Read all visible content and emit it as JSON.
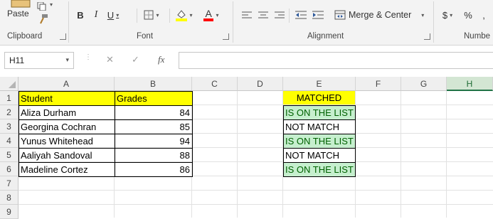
{
  "ribbon": {
    "clipboard": {
      "paste_label": "Paste",
      "group_label": "Clipboard"
    },
    "font": {
      "bold": "B",
      "italic": "I",
      "underline": "U",
      "font_color_letter": "A",
      "group_label": "Font",
      "highlight_color": "#ffff00",
      "font_color": "#ff0000"
    },
    "alignment": {
      "merge_label": "Merge & Center",
      "group_label": "Alignment"
    },
    "number": {
      "currency": "$",
      "percent": "%",
      "group_label": "Numbe"
    }
  },
  "formula_bar": {
    "name_box": "H11",
    "fx": "fx",
    "cancel": "✕",
    "enter": "✓",
    "formula": ""
  },
  "sheet": {
    "columns": [
      "A",
      "B",
      "C",
      "D",
      "E",
      "F",
      "G",
      "H"
    ],
    "selected_column": "H",
    "rows": [
      "1",
      "2",
      "3",
      "4",
      "5",
      "6",
      "7",
      "8",
      "9"
    ],
    "headers": {
      "student": "Student",
      "grades": "Grades",
      "matched": "MATCHED"
    },
    "students": [
      {
        "name": "Aliza Durham",
        "grade": "84",
        "matched": "IS ON THE LIST"
      },
      {
        "name": "Georgina Cochran",
        "grade": "85",
        "matched": "NOT MATCH"
      },
      {
        "name": "Yunus Whitehead",
        "grade": "94",
        "matched": "IS ON THE LIST"
      },
      {
        "name": "Aaliyah Sandoval",
        "grade": "88",
        "matched": "NOT MATCH"
      },
      {
        "name": "Madeline Cortez",
        "grade": "86",
        "matched": "IS ON THE LIST"
      }
    ],
    "colors": {
      "header_fill": "#ffff00",
      "match_fill": "#c6efce",
      "match_text": "#006100"
    }
  }
}
